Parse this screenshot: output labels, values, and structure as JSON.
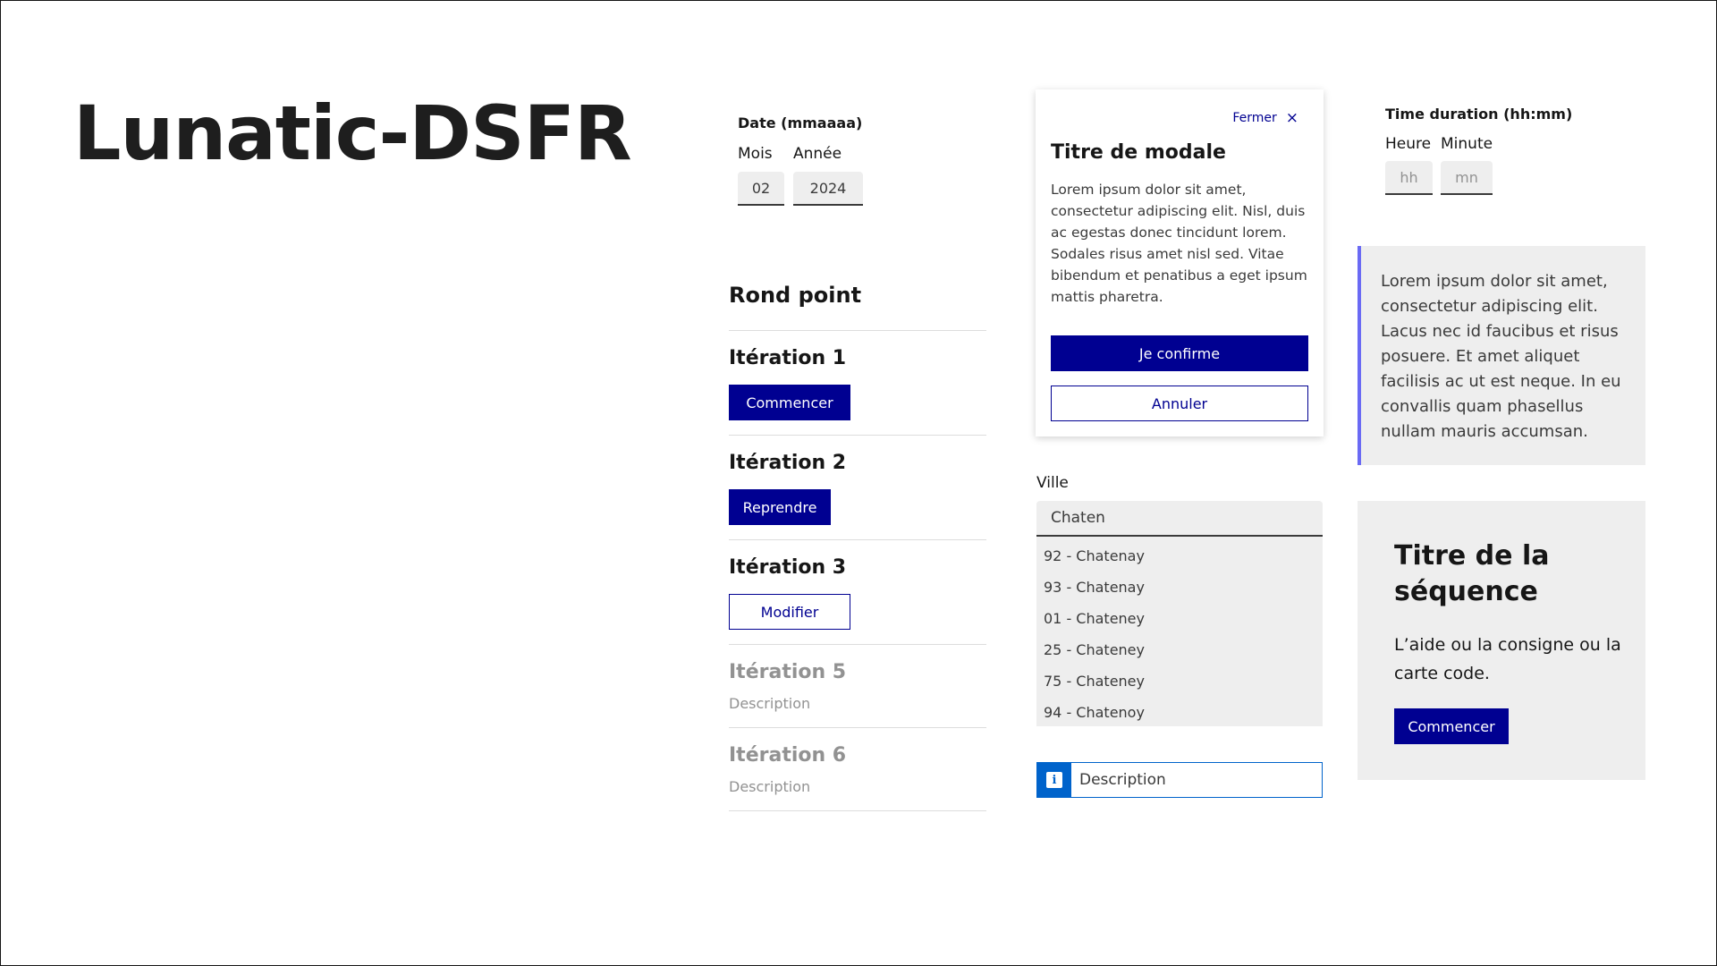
{
  "page": {
    "title": "Lunatic-DSFR"
  },
  "date_field": {
    "legend": "Date (mmaaaa)",
    "month_label": "Mois",
    "year_label": "Année",
    "month_value": "02",
    "year_value": "2024"
  },
  "roundabout": {
    "title": "Rond point",
    "iterations": [
      {
        "title": "Itération 1",
        "button": "Commencer"
      },
      {
        "title": "Itération 2",
        "button": "Reprendre"
      },
      {
        "title": "Itération 3",
        "button": "Modifier"
      },
      {
        "title": "Itération 5",
        "description": "Description"
      },
      {
        "title": "Itération 6",
        "description": "Description"
      }
    ]
  },
  "modal": {
    "close_label": "Fermer",
    "close_icon": "×",
    "title": "Titre de modale",
    "body": "Lorem ipsum dolor sit amet, consectetur adipiscing elit. Nisl, duis ac egestas donec tincidunt lorem. Sodales risus amet nisl sed. Vitae bibendum et penatibus a eget ipsum mattis pharetra.",
    "confirm_label": "Je confirme",
    "cancel_label": "Annuler"
  },
  "city": {
    "label": "Ville",
    "value": "Chaten",
    "options": [
      "92 - Chatenay",
      "93 - Chatenay",
      "01 - Chateney",
      "25 - Chateney",
      "75 - Chateney",
      "94 - Chatenoy"
    ]
  },
  "info_input": {
    "icon": "i",
    "value": "Description"
  },
  "time_duration": {
    "legend": "Time duration (hh:mm)",
    "hour_label": "Heure",
    "minute_label": "Minute",
    "hour_placeholder": "hh",
    "minute_placeholder": "mn"
  },
  "callout": {
    "text": "Lorem ipsum dolor sit amet, consectetur adipiscing elit. Lacus nec id faucibus et risus posuere. Et amet aliquet facilisis ac ut est neque. In eu convallis quam phasellus nullam mauris accumsan."
  },
  "sequence": {
    "title": "Titre de la séquence",
    "description": "L’aide ou la consigne ou la carte code.",
    "button": "Commencer"
  },
  "colors": {
    "primary": "#000091",
    "info": "#0063cb",
    "callout_accent": "#6a6af4",
    "surface": "#eeeeee"
  }
}
